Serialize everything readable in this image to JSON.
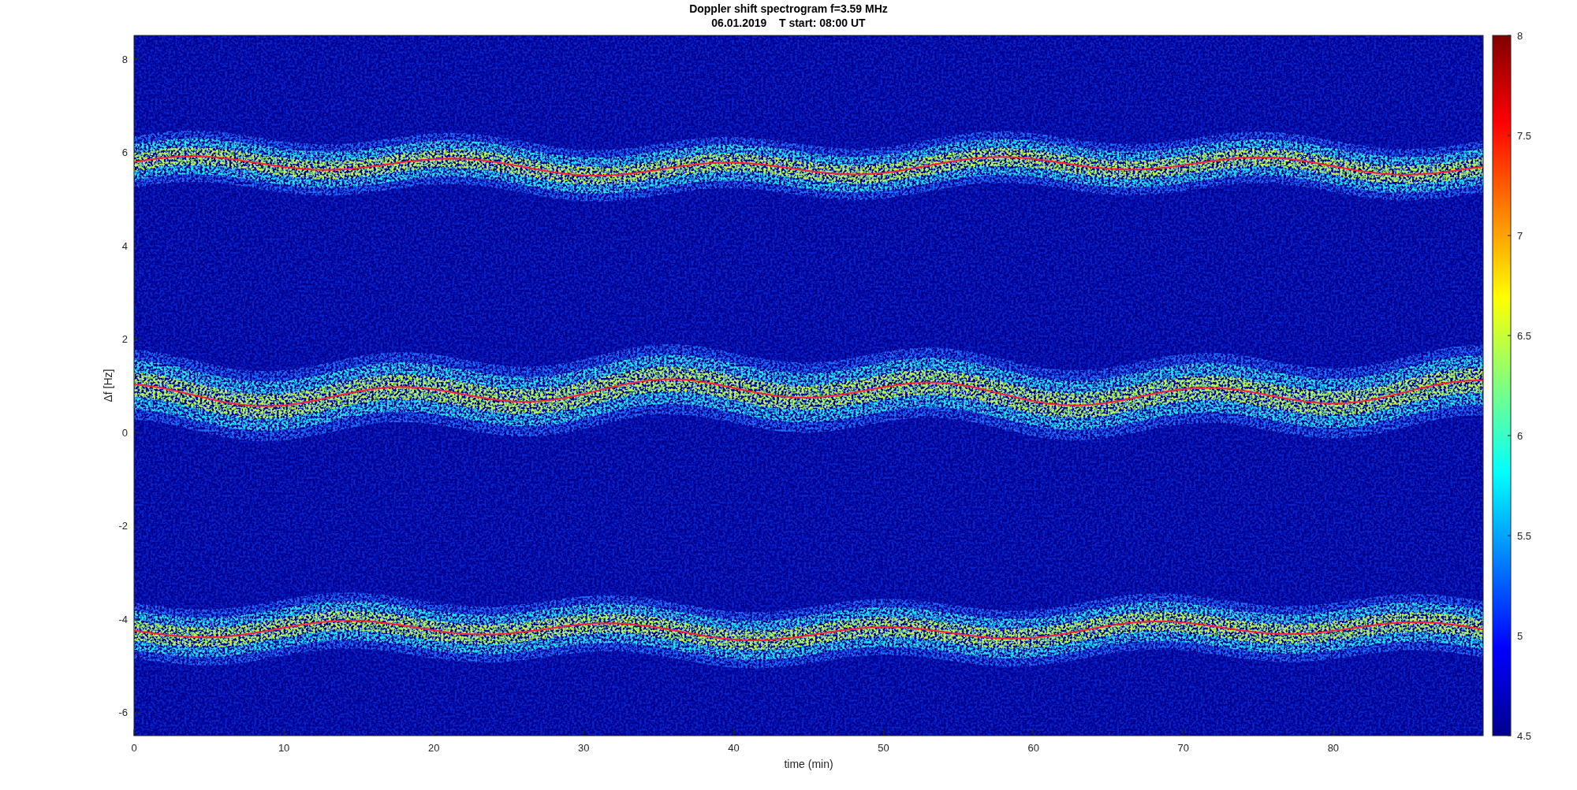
{
  "figure": {
    "title_lines": [
      "Doppler shift spectrogram f=3.59 MHz",
      "06.01.2019    T start: 08:00 UT"
    ],
    "axes": {
      "xlabel": "time (min)",
      "ylabel": "Δf [Hz]",
      "xticks": [
        "0",
        "10",
        "20",
        "30",
        "40",
        "50",
        "60",
        "70",
        "80"
      ],
      "yticks": [
        "8",
        "6",
        "4",
        "2",
        "0",
        "-2",
        "-4",
        "-6"
      ]
    },
    "colorbar": {
      "ticks": [
        "8",
        "7.5",
        "7",
        "6.5",
        "6",
        "5.5",
        "5",
        "4.5"
      ]
    }
  }
}
